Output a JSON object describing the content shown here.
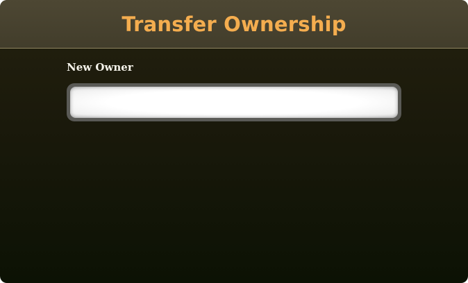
{
  "dialog": {
    "title": "Transfer Ownership"
  },
  "form": {
    "new_owner_label": "New Owner",
    "new_owner_value": "",
    "new_owner_placeholder": ""
  },
  "colors": {
    "title": "#f4ad4f",
    "header_bg": "#4d4733",
    "body_bg": "#1a190b",
    "label": "#f5f3ea"
  }
}
